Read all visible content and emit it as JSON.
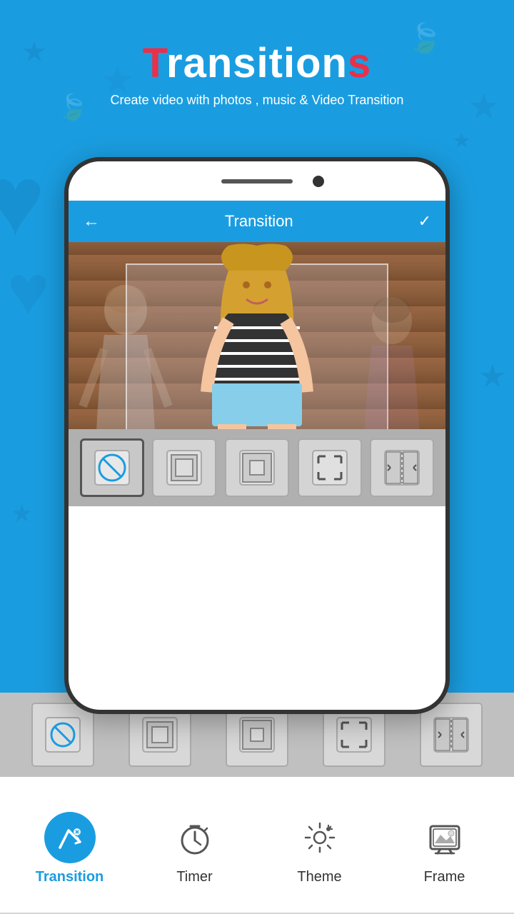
{
  "app": {
    "title_t": "T",
    "title_rest": "ransition",
    "title_s": "s",
    "subtitle": "Create video with photos , music &  Video Transition"
  },
  "header": {
    "title": "Transition",
    "back_icon": "←",
    "check_icon": "✓"
  },
  "transition_buttons": [
    {
      "id": "none",
      "label": "No transition",
      "icon": "none"
    },
    {
      "id": "box1",
      "label": "Box small",
      "icon": "box-small"
    },
    {
      "id": "box2",
      "label": "Box medium",
      "icon": "box-medium"
    },
    {
      "id": "expand",
      "label": "Expand",
      "icon": "expand"
    },
    {
      "id": "split",
      "label": "Split",
      "icon": "split"
    }
  ],
  "inner_buttons": [
    {
      "id": "none",
      "label": "No transition",
      "icon": "none"
    },
    {
      "id": "box1",
      "label": "Box small",
      "icon": "box-small"
    },
    {
      "id": "box2",
      "label": "Box medium",
      "icon": "box-medium"
    },
    {
      "id": "expand",
      "label": "Expand",
      "icon": "expand"
    },
    {
      "id": "split",
      "label": "Split",
      "icon": "split"
    }
  ],
  "nav": {
    "items": [
      {
        "id": "transition",
        "label": "Transition",
        "active": true
      },
      {
        "id": "timer",
        "label": "Timer",
        "active": false
      },
      {
        "id": "theme",
        "label": "Theme",
        "active": false
      },
      {
        "id": "frame",
        "label": "Frame",
        "active": false
      }
    ]
  }
}
